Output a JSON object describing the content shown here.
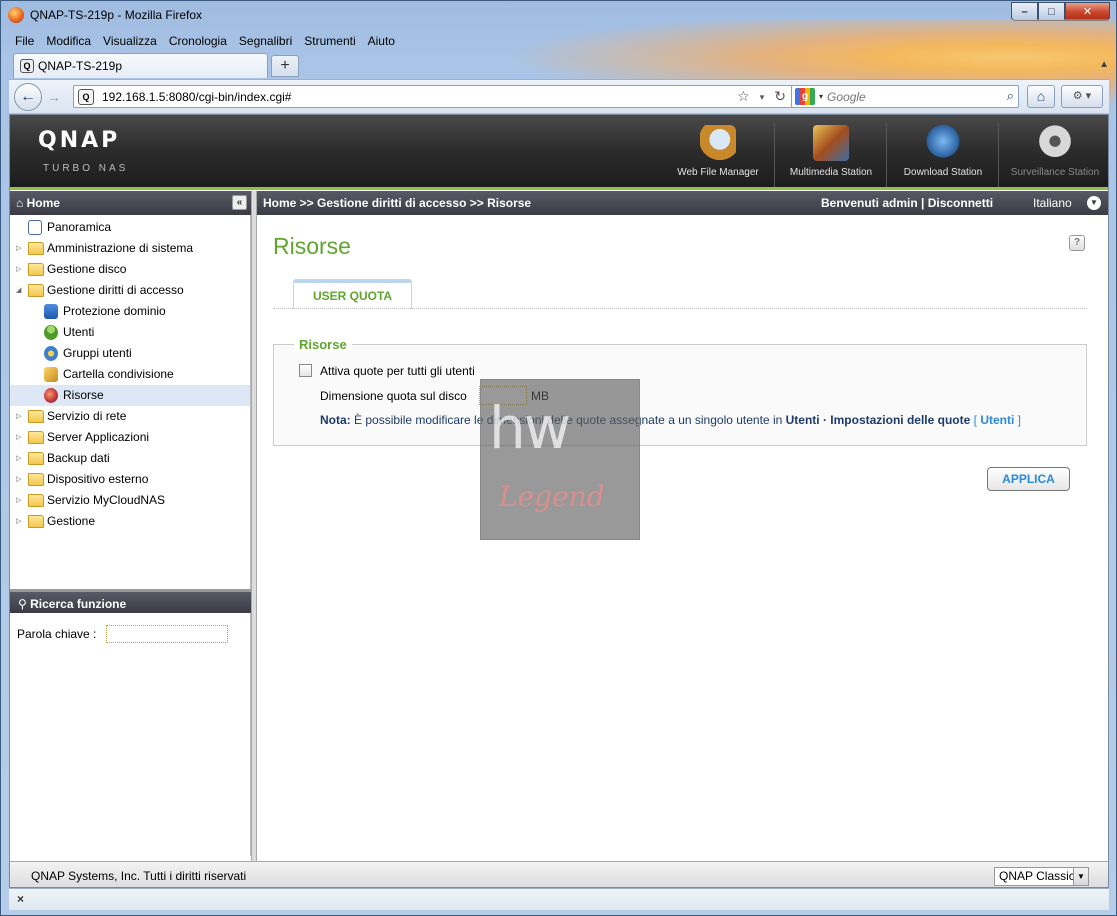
{
  "browser": {
    "title": "QNAP-TS-219p - Mozilla Firefox",
    "menu": [
      "File",
      "Modifica",
      "Visualizza",
      "Cronologia",
      "Segnalibri",
      "Strumenti",
      "Aiuto"
    ],
    "tab_title": "QNAP-TS-219p",
    "url": "192.168.1.5:8080/cgi-bin/index.cgi#",
    "search_placeholder": "Google",
    "window_buttons": {
      "minimize": "–",
      "maximize": "□",
      "close": "✕"
    }
  },
  "qnap": {
    "logo": "QNAP",
    "tagline": "Turbo NAS",
    "apps": [
      {
        "label": "Web File Manager",
        "icon": "web-file-manager-icon"
      },
      {
        "label": "Multimedia Station",
        "icon": "multimedia-station-icon"
      },
      {
        "label": "Download Station",
        "icon": "download-station-icon"
      },
      {
        "label": "Surveillance Station",
        "icon": "surveillance-station-icon"
      }
    ]
  },
  "sidebar": {
    "home_label": "Home",
    "items": [
      {
        "label": "Panoramica",
        "level": 0,
        "type": "leaf"
      },
      {
        "label": "Amministrazione di sistema",
        "level": 0,
        "type": "folder"
      },
      {
        "label": "Gestione disco",
        "level": 0,
        "type": "folder"
      },
      {
        "label": "Gestione diritti di accesso",
        "level": 0,
        "type": "folder-open"
      },
      {
        "label": "Protezione dominio",
        "level": 1,
        "type": "leaf"
      },
      {
        "label": "Utenti",
        "level": 1,
        "type": "leaf"
      },
      {
        "label": "Gruppi utenti",
        "level": 1,
        "type": "leaf"
      },
      {
        "label": "Cartella condivisione",
        "level": 1,
        "type": "leaf"
      },
      {
        "label": "Risorse",
        "level": 1,
        "type": "leaf",
        "selected": true
      },
      {
        "label": "Servizio di rete",
        "level": 0,
        "type": "folder"
      },
      {
        "label": "Server Applicazioni",
        "level": 0,
        "type": "folder"
      },
      {
        "label": "Backup dati",
        "level": 0,
        "type": "folder"
      },
      {
        "label": "Dispositivo esterno",
        "level": 0,
        "type": "folder"
      },
      {
        "label": "Servizio MyCloudNAS",
        "level": 0,
        "type": "folder"
      },
      {
        "label": "Gestione",
        "level": 0,
        "type": "folder"
      }
    ]
  },
  "search": {
    "title": "Ricerca funzione",
    "keyword_label": "Parola chiave :",
    "keyword_value": ""
  },
  "header": {
    "breadcrumb": "Home >> Gestione diritti di accesso >> Risorse",
    "welcome": "Benvenuti admin | Disconnetti",
    "language": "Italiano"
  },
  "main": {
    "title": "Risorse",
    "tab": "USER QUOTA",
    "section_title": "Risorse",
    "checkbox_label": "Attiva quote per tutti gli utenti",
    "checkbox_checked": false,
    "quota_label": "Dimensione quota sul disco",
    "quota_value": "",
    "quota_unit": "MB",
    "note_prefix": "Nota:",
    "note_text": " È possibile modificare le dimensioni delle quote assegnate a un singolo utente in ",
    "note_path": "Utenti · Impostazioni delle quote",
    "note_link_open": " [ ",
    "note_link": "Utenti",
    "note_link_close": " ]",
    "apply_label": "APPLICA"
  },
  "watermark": {
    "line1": "HW",
    "line2": "Legend"
  },
  "footer": {
    "copyright": "QNAP Systems, Inc. Tutti i diritti riservati",
    "theme": "QNAP Classic"
  },
  "statusbar": {
    "close": "×"
  },
  "colors": {
    "accent_green": "#5fa52e",
    "link_blue": "#2a8ad6",
    "header_dark": "#3b3b45",
    "qnap_green_line": "#8cc63f"
  }
}
